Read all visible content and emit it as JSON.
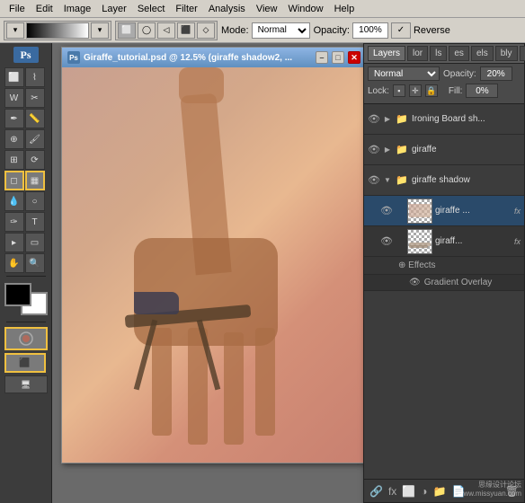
{
  "menubar": {
    "items": [
      "File",
      "Edit",
      "Image",
      "Layer",
      "Select",
      "Filter",
      "Analysis",
      "View",
      "Window",
      "Help"
    ]
  },
  "toolbar": {
    "mode_label": "Mode:",
    "mode_value": "Normal",
    "opacity_label": "Opacity:",
    "opacity_value": "100%",
    "reverse_label": "Reverse"
  },
  "document": {
    "title": "Giraffe_tutorial.psd @ 12.5% (giraffe shadow2, ...",
    "ps_icon": "Ps"
  },
  "layers_panel": {
    "tabs": [
      "Layers",
      "lor",
      "ls",
      "es",
      "els",
      "bly",
      "lns"
    ],
    "blend_mode": "Normal",
    "opacity_label": "Opacity:",
    "opacity_value": "20%",
    "lock_label": "Lock:",
    "fill_label": "Fill:",
    "fill_value": "0%",
    "layers": [
      {
        "name": "Ironing Board sh...",
        "type": "folder",
        "visible": true,
        "expanded": false
      },
      {
        "name": "giraffe",
        "type": "folder",
        "visible": true,
        "expanded": false
      },
      {
        "name": "giraffe shadow",
        "type": "folder",
        "visible": true,
        "expanded": true,
        "sublayers": [
          {
            "name": "giraffe ... fx",
            "type": "layer",
            "visible": true,
            "has_fx": true,
            "thumb": "gradient"
          },
          {
            "name": "giraff... fx",
            "type": "layer",
            "visible": true,
            "has_fx": true,
            "thumb": "stroke",
            "effects": true,
            "effect_items": [
              {
                "name": "Effects"
              },
              {
                "name": "Gradient Overlay"
              }
            ]
          }
        ]
      }
    ]
  },
  "watermark": {
    "line1": "思缘设计论坛",
    "line2": "www.missyuan.com"
  }
}
